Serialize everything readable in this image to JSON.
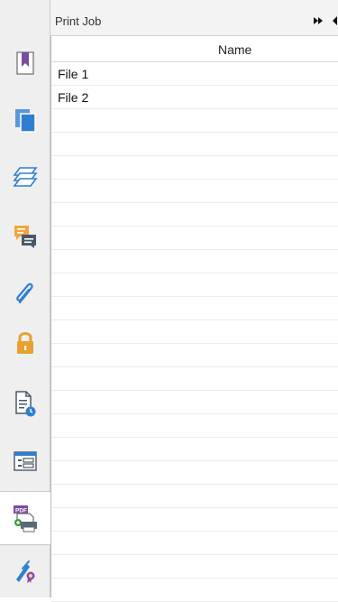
{
  "panel": {
    "title": "Print Job",
    "column_header": "Name",
    "rows": [
      "File 1",
      "File 2",
      "",
      "",
      "",
      "",
      "",
      "",
      "",
      "",
      "",
      "",
      "",
      "",
      "",
      "",
      "",
      "",
      "",
      "",
      "",
      "",
      ""
    ]
  },
  "sidebar": {
    "buttons": [
      {
        "name": "bookmarks-icon"
      },
      {
        "name": "pages-icon"
      },
      {
        "name": "layers-icon"
      },
      {
        "name": "comments-icon"
      },
      {
        "name": "attachments-icon"
      },
      {
        "name": "security-icon"
      },
      {
        "name": "document-history-icon"
      },
      {
        "name": "form-fields-icon"
      },
      {
        "name": "print-job-icon"
      },
      {
        "name": "signatures-icon"
      }
    ],
    "active": "print-job-icon"
  },
  "colors": {
    "bookmark_purple": "#7a4ca0",
    "blue": "#2f7fd0",
    "orange": "#e8a030",
    "gray_icon": "#4a5868"
  }
}
